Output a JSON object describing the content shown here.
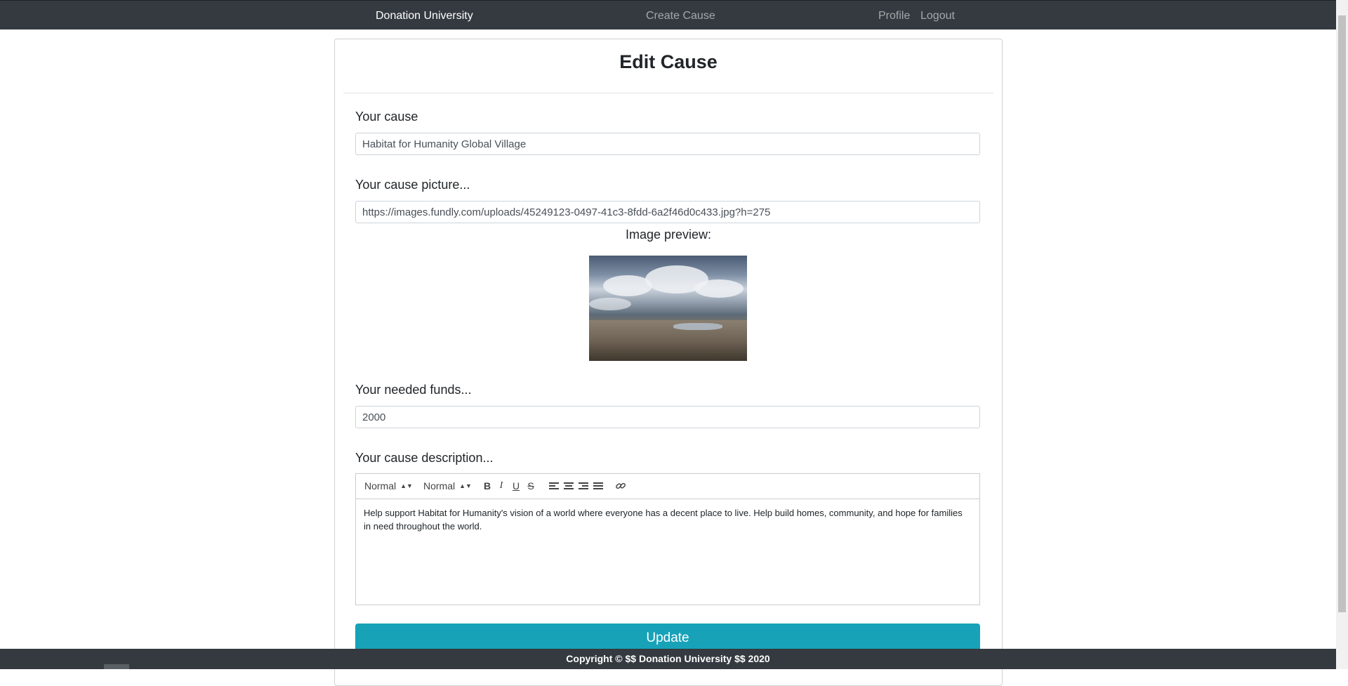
{
  "navbar": {
    "brand": "Donation University",
    "create_cause": "Create Cause",
    "profile": "Profile",
    "logout": "Logout"
  },
  "form": {
    "title": "Edit Cause",
    "cause_label": "Your cause",
    "cause_value": "Habitat for Humanity Global Village",
    "picture_label": "Your cause picture...",
    "picture_value": "https://images.fundly.com/uploads/45249123-0497-41c3-8fdd-6a2f46d0c433.jpg?h=275",
    "preview_label": "Image preview:",
    "funds_label": "Your needed funds...",
    "funds_value": "2000",
    "description_label": "Your cause description...",
    "update_label": "Update"
  },
  "editor": {
    "font_select": "Normal",
    "size_select": "Normal",
    "bold": "B",
    "italic": "I",
    "underline": "U",
    "strike": "S",
    "content": "Help support Habitat for Humanity's vision of a world where everyone has a decent place to live. Help build homes, community, and hope for families in need throughout the world."
  },
  "footer": {
    "text": "Copyright © $$ Donation University $$ 2020"
  },
  "colors": {
    "navbar": "#343a40",
    "primary_button": "#17a2b8"
  },
  "icons": [
    "bold-icon",
    "italic-icon",
    "underline-icon",
    "strikethrough-icon",
    "align-left-icon",
    "align-center-icon",
    "align-right-icon",
    "align-justify-icon",
    "link-icon"
  ]
}
